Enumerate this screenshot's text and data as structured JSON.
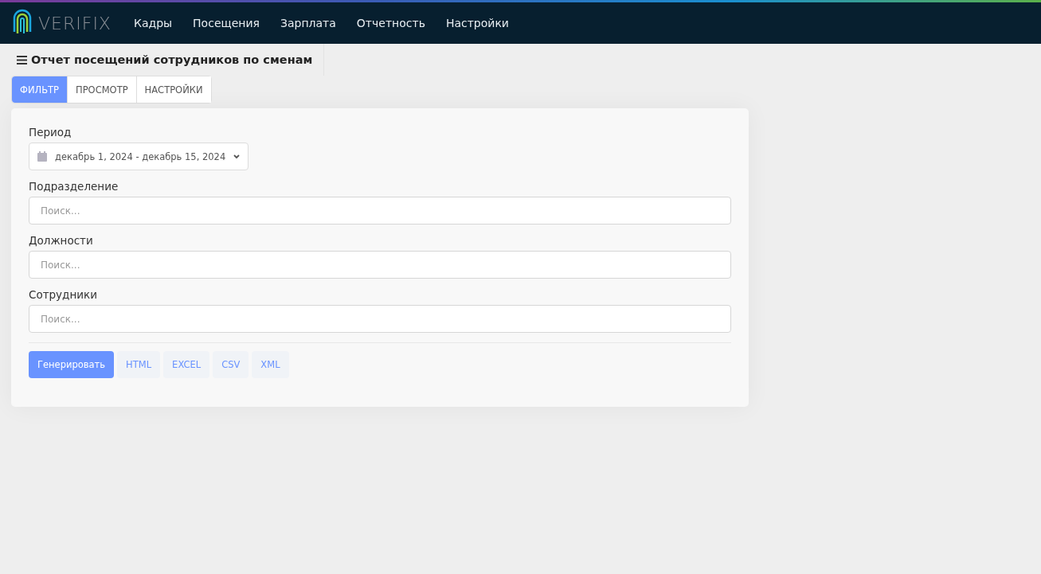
{
  "navbar": {
    "logo": "VERIFIX",
    "items": [
      {
        "label": "Кадры"
      },
      {
        "label": "Посещения"
      },
      {
        "label": "Зарплата"
      },
      {
        "label": "Отчетность"
      },
      {
        "label": "Настройки"
      }
    ]
  },
  "page": {
    "title": "Отчет посещений сотрудников по сменам"
  },
  "tabs": [
    {
      "label": "ФИЛЬТР",
      "selected": true
    },
    {
      "label": "ПРОСМОТР",
      "selected": false
    },
    {
      "label": "НАСТРОЙКИ",
      "selected": false
    }
  ],
  "form": {
    "fields": [
      {
        "kind": "daterange",
        "label": "Период",
        "value": "декабрь 1, 2024 - декабрь 15, 2024"
      },
      {
        "kind": "search",
        "label": "Подразделение",
        "placeholder": "Поиск..."
      },
      {
        "kind": "search",
        "label": "Должности",
        "placeholder": "Поиск..."
      },
      {
        "kind": "search",
        "label": "Сотрудники",
        "placeholder": "Поиск..."
      }
    ],
    "buttons": [
      {
        "label": "Генерировать",
        "kind": "primary"
      },
      {
        "label": "HTML",
        "kind": "light"
      },
      {
        "label": "EXCEL",
        "kind": "light"
      },
      {
        "label": "CSV",
        "kind": "light"
      },
      {
        "label": "XML",
        "kind": "light"
      }
    ]
  }
}
